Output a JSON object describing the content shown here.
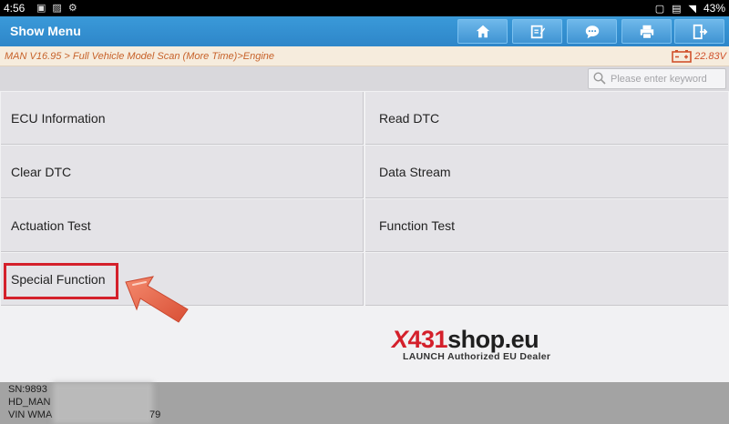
{
  "statusbar": {
    "time": "4:56",
    "battery": "43%"
  },
  "header": {
    "title": "Show Menu"
  },
  "toolbar": {
    "buttons": [
      {
        "name": "home-button",
        "icon": "home-icon"
      },
      {
        "name": "report-button",
        "icon": "edit-report-icon"
      },
      {
        "name": "feedback-button",
        "icon": "chat-bubble-icon"
      },
      {
        "name": "print-button",
        "icon": "printer-icon"
      },
      {
        "name": "exit-button",
        "icon": "exit-icon"
      }
    ]
  },
  "breadcrumb": "MAN V16.95 > Full Vehicle Model Scan (More Time)>Engine",
  "voltage": "22.83V",
  "search": {
    "placeholder": "Please enter keyword",
    "value": ""
  },
  "menu": {
    "items": [
      {
        "label": "ECU Information"
      },
      {
        "label": "Read DTC"
      },
      {
        "label": "Clear DTC"
      },
      {
        "label": "Data Stream"
      },
      {
        "label": "Actuation Test"
      },
      {
        "label": "Function Test"
      },
      {
        "label": "Special Function"
      },
      {
        "label": ""
      }
    ]
  },
  "watermark": {
    "x": "X",
    "num": "431",
    "rest": "shop.eu",
    "subtitle": "LAUNCH Authorized EU Dealer"
  },
  "footer": {
    "sn": "SN:9893",
    "model": "HD_MAN",
    "vin_prefix": "VIN WMA",
    "vin_suffix": "79"
  },
  "colors": {
    "titlebar": "#2e86c9",
    "breadcrumb_bg": "#f6ecdd",
    "breadcrumb_text": "#c7622a",
    "highlight": "#d4202b",
    "arrow": "#e8664a"
  }
}
